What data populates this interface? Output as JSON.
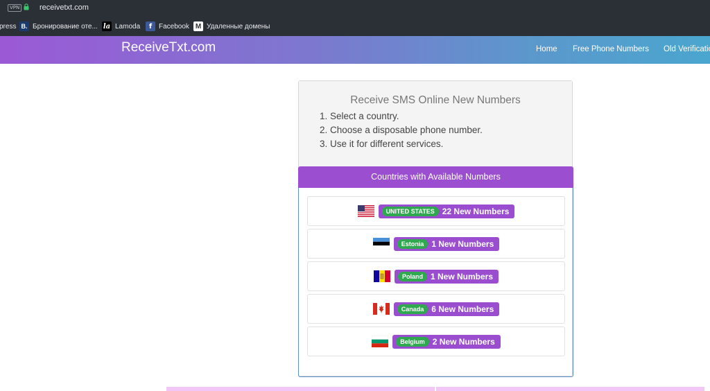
{
  "browser": {
    "vpn_label": "VPN",
    "url": "receivetxt.com"
  },
  "bookmarks": [
    {
      "label": "press",
      "icon": "none"
    },
    {
      "label": "Бронирование оте...",
      "icon": "booking-icon"
    },
    {
      "label": "Lamoda",
      "icon": "lamoda-icon"
    },
    {
      "label": "Facebook",
      "icon": "facebook-icon"
    },
    {
      "label": "Удаленные домены",
      "icon": "m-icon"
    }
  ],
  "site": {
    "brand": "ReceiveTxt.com",
    "nav": [
      "Home",
      "Free Phone Numbers",
      "Old Verificatio"
    ]
  },
  "intro": {
    "title": "Receive SMS Online New Numbers",
    "steps": [
      "1. Select a country.",
      "2. Choose a disposable phone number.",
      "3. Use it for different services."
    ]
  },
  "countries": {
    "heading": "Countries with Available Numbers",
    "items": [
      {
        "country": "UNITED STATES",
        "count": "22 New Numbers",
        "flag": "us-flag-icon"
      },
      {
        "country": "Estonia",
        "count": "1 New Numbers",
        "flag": "estonia-flag-icon"
      },
      {
        "country": "Poland",
        "count": "1 New Numbers",
        "flag": "andorra-style-flag-icon"
      },
      {
        "country": "Canada",
        "count": "6 New Numbers",
        "flag": "canada-flag-icon"
      },
      {
        "country": "Belgium",
        "count": "2 New Numbers",
        "flag": "bulgaria-flag-icon"
      }
    ]
  },
  "colors": {
    "accent_purple": "#9b4fd0",
    "tag_green": "#2fa84f",
    "header_gradient_start": "#9b59d6",
    "header_gradient_end": "#4aa6cf"
  }
}
